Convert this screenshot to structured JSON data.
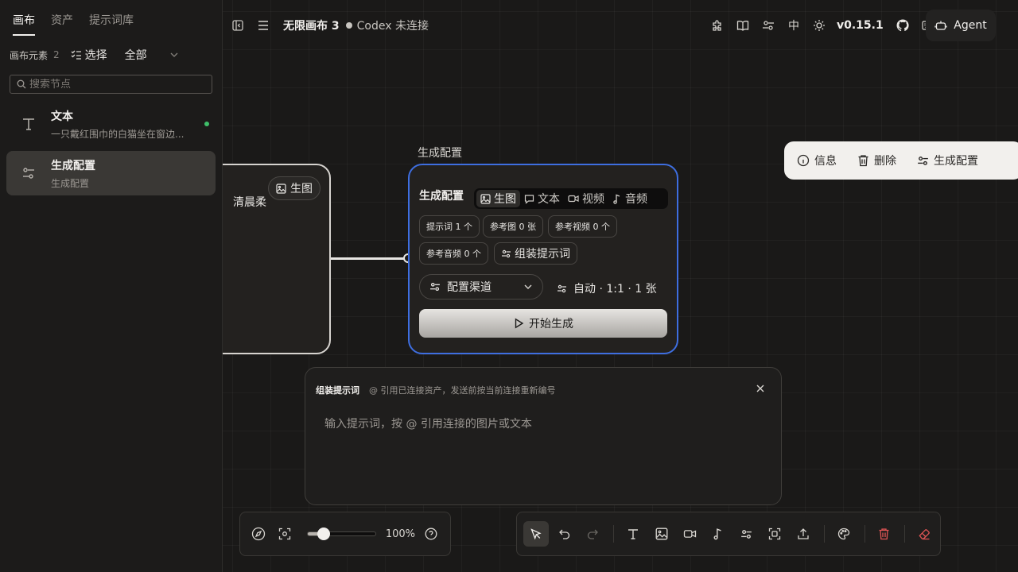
{
  "sidebar": {
    "tabs": [
      {
        "label": "画布"
      },
      {
        "label": "资产"
      },
      {
        "label": "提示词库"
      }
    ],
    "filter": {
      "label": "画布元素",
      "count": "2",
      "select_label": "选择",
      "all_label": "全部"
    },
    "search": {
      "placeholder": "搜索节点",
      "value": ""
    },
    "items": [
      {
        "title": "文本",
        "subtitle": "一只戴红围巾的白猫坐在窗边...",
        "icon": "text-t-icon",
        "status_dot": true
      },
      {
        "title": "生成配置",
        "subtitle": "生成配置",
        "icon": "sliders-icon"
      }
    ]
  },
  "topbar": {
    "title": "无限画布 3",
    "status": "Codex 未连接",
    "lang": "中",
    "version": "v0.15.1",
    "agent_label": "Agent"
  },
  "nodes": {
    "left_node": {
      "text": "清晨柔",
      "chip_label": "生图"
    },
    "gen_config": {
      "label": "生成配置",
      "header": "生成配置",
      "modes": [
        {
          "label": "生图",
          "icon": "image-icon"
        },
        {
          "label": "文本",
          "icon": "chat-icon"
        },
        {
          "label": "视频",
          "icon": "video-icon"
        },
        {
          "label": "音频",
          "icon": "music-icon"
        }
      ],
      "pills": {
        "prompt": "提示词 1 个",
        "ref_image": "参考图 0 张",
        "ref_video": "参考视频 0 个",
        "ref_audio": "参考音频 0 个",
        "assemble": "组装提示词"
      },
      "channel_label": "配置渠道",
      "auto_label": "自动 · 1:1 · 1 张",
      "start_label": "开始生成"
    }
  },
  "context_toolbar": {
    "items": [
      {
        "label": "信息"
      },
      {
        "label": "删除"
      },
      {
        "label": "生成配置"
      }
    ]
  },
  "composer": {
    "title": "组装提示词",
    "hint": "@ 引用已连接资产，发送前按当前连接重新编号",
    "placeholder": "输入提示词，按 @ 引用连接的图片或文本",
    "value": ""
  },
  "zoom": {
    "percent": "100%",
    "slider_fraction": 0.23
  },
  "colors": {
    "accent_blue": "#3e6ee0",
    "danger_red": "#e05555",
    "online_green": "#3fbf6a"
  }
}
